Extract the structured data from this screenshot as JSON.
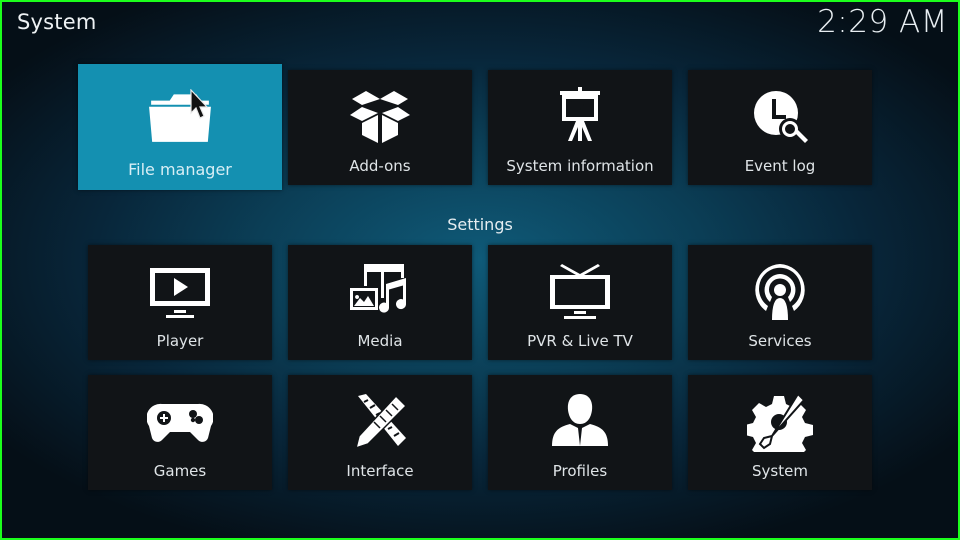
{
  "header": {
    "title": "System",
    "clock": "2:29 AM"
  },
  "top_row": [
    {
      "label": "File manager",
      "icon": "folder-icon",
      "focused": true
    },
    {
      "label": "Add-ons",
      "icon": "box-icon",
      "focused": false
    },
    {
      "label": "System information",
      "icon": "presentation-board-icon",
      "focused": false
    },
    {
      "label": "Event log",
      "icon": "clock-search-icon",
      "focused": false
    }
  ],
  "settings": {
    "heading": "Settings",
    "items": [
      {
        "label": "Player",
        "icon": "monitor-play-icon"
      },
      {
        "label": "Media",
        "icon": "media-film-picture-music-icon"
      },
      {
        "label": "PVR & Live TV",
        "icon": "tv-antenna-icon"
      },
      {
        "label": "Services",
        "icon": "broadcast-person-icon"
      },
      {
        "label": "Games",
        "icon": "gamepad-icon"
      },
      {
        "label": "Interface",
        "icon": "ruler-pencil-icon"
      },
      {
        "label": "Profiles",
        "icon": "user-profile-icon"
      },
      {
        "label": "System",
        "icon": "gear-wrench-icon"
      }
    ]
  },
  "colors": {
    "focus_accent": "#1490b1",
    "tile_background": "#111417",
    "border": "#1cff1c"
  }
}
